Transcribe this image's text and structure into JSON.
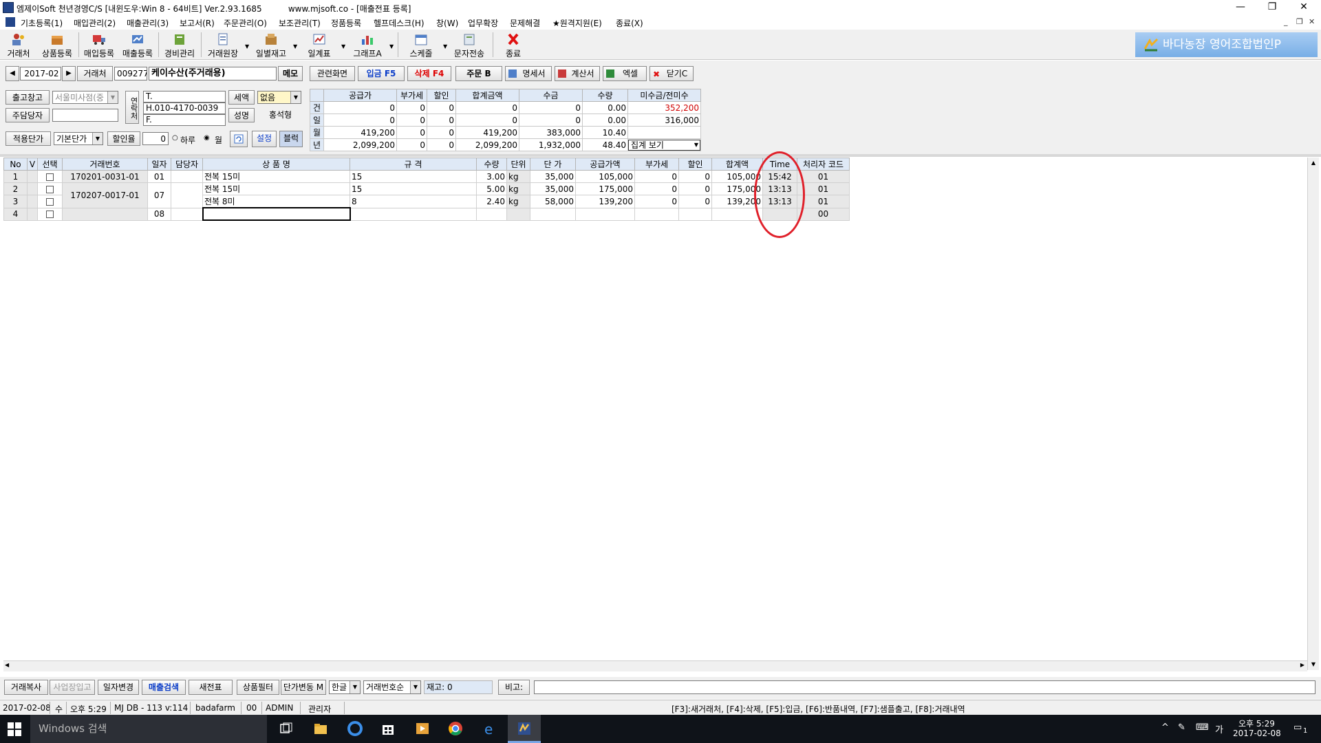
{
  "window": {
    "title": "엠제이Soft 천년경영C/S [내윈도우:Win 8 - 64비트] Ver.2.93.1685          www.mjsoft.co - [매출전표 등록]"
  },
  "menu": [
    "기초등록(1)",
    "매입관리(2)",
    "매출관리(3)",
    "보고서(R)",
    "주문관리(O)",
    "보조관리(T)",
    "정품등록",
    "헬프데스크(H)",
    "창(W)",
    "업무확장",
    "문제해결",
    "★원격지원(E)",
    "종료(X)"
  ],
  "toolbar": {
    "buttons": [
      "거래처",
      "상품등록",
      "매입등록",
      "매출등록",
      "경비관리",
      "거래원장",
      "일별재고",
      "일계표",
      "그래프A",
      "스케줄",
      "문자전송",
      "종료"
    ],
    "banner": "바다농장 영어조합법인P"
  },
  "header": {
    "period": "2017-02",
    "client_label": "거래처",
    "client_code": "009277",
    "client_name": "케이수산(주거래용)",
    "memo_label": "메모",
    "warehouse_label": "출고창고",
    "warehouse_value": "서울미사점(중",
    "manager_label": "주담당자",
    "manager_value": "",
    "price_label": "적용단가",
    "price_value": "기본단가",
    "discount_label": "할인율",
    "discount_value": "0",
    "radio_day": "하루",
    "radio_month": "월",
    "contact_side": "연락처",
    "phone_t": "T.",
    "phone_h": "H.010-4170-0039",
    "phone_f": "F.",
    "tax_label": "세액",
    "tax_value": "없음",
    "name_label": "성명",
    "name_value": "홍석형",
    "set_label": "설정",
    "block_label": "블럭"
  },
  "actions": [
    "관련화면",
    "입금 F5",
    "삭제 F4",
    "주문 B",
    "명세서",
    "계산서",
    "엑셀",
    "닫기C"
  ],
  "summary": {
    "headers": [
      "",
      "공급가",
      "부가세",
      "할인",
      "합계금액",
      "수금",
      "수량",
      "미수금/전미수"
    ],
    "rows": [
      {
        "label": "건",
        "values": [
          "0",
          "0",
          "0",
          "0",
          "0",
          "0.00",
          "352,200"
        ]
      },
      {
        "label": "일",
        "values": [
          "0",
          "0",
          "0",
          "0",
          "0",
          "0.00",
          "316,000"
        ]
      },
      {
        "label": "월",
        "values": [
          "419,200",
          "0",
          "0",
          "419,200",
          "383,000",
          "10.40",
          ""
        ]
      },
      {
        "label": "년",
        "values": [
          "2,099,200",
          "0",
          "0",
          "2,099,200",
          "1,932,000",
          "48.40",
          ""
        ]
      }
    ],
    "view_select": "집계 보기"
  },
  "grid": {
    "headers": [
      "No",
      "V",
      "선택",
      "거래번호",
      "일자",
      "담당자",
      "상 품 명",
      "규 격",
      "수량",
      "단위",
      "단 가",
      "공급가액",
      "부가세",
      "할인",
      "합계액",
      "Time",
      "처리자 코드"
    ],
    "rows": [
      {
        "no": "1",
        "trade": "170201-0031-01",
        "day": "01",
        "product": "전복 15미",
        "spec": "15",
        "qty": "3.00",
        "unit": "kg",
        "price": "35,000",
        "supply": "105,000",
        "vat": "0",
        "disc": "0",
        "total": "105,000",
        "time": "15:42",
        "code": "01"
      },
      {
        "no": "2",
        "trade": "170207-0017-01",
        "day": "07",
        "product": "전복 15미",
        "spec": "15",
        "qty": "5.00",
        "unit": "kg",
        "price": "35,000",
        "supply": "175,000",
        "vat": "0",
        "disc": "0",
        "total": "175,000",
        "time": "13:13",
        "code": "01"
      },
      {
        "no": "3",
        "trade": "",
        "day": "",
        "product": "전복 8미",
        "spec": "8",
        "qty": "2.40",
        "unit": "kg",
        "price": "58,000",
        "supply": "139,200",
        "vat": "0",
        "disc": "0",
        "total": "139,200",
        "time": "13:13",
        "code": "01"
      },
      {
        "no": "4",
        "trade": "",
        "day": "08",
        "product": "",
        "spec": "",
        "qty": "",
        "unit": "",
        "price": "",
        "supply": "",
        "vat": "",
        "disc": "",
        "total": "",
        "time": "",
        "code": "00"
      }
    ]
  },
  "bottom": {
    "buttons": [
      "거래복사",
      "사업장입고",
      "일자변경",
      "매출검색",
      "새전표",
      "상품필터",
      "단가변동 M"
    ],
    "lang_select": "한글",
    "sort_select": "거래번호순",
    "stock_label": "재고: 0",
    "note_label": "비고:"
  },
  "status": {
    "date": "2017-02-08",
    "weekday": "수",
    "time": "오후 5:29",
    "db": "MJ DB - 113 v:114",
    "user": "badafarm",
    "code": "00",
    "admin": "ADMIN",
    "role": "관리자",
    "hotkeys": "[F3]:새거래처, [F4]:삭제, [F5]:입금, [F6]:반품내역, [F7]:샘플출고, [F8]:거래내역"
  },
  "taskbar": {
    "search_placeholder": "Windows 검색",
    "ime": "가",
    "clock_time": "오후 5:29",
    "clock_date": "2017-02-08",
    "notifications": "1"
  },
  "colors": {
    "header_bg": "#dfe9f6",
    "accent_red": "#d00000",
    "accent_blue": "#0a3cc8",
    "annotation_circle": "#e0202a"
  }
}
